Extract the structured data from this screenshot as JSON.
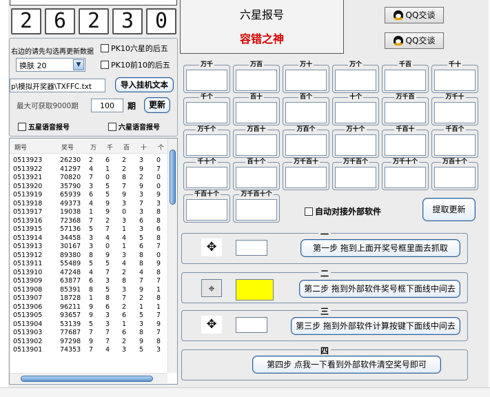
{
  "digits": [
    "2",
    "6",
    "2",
    "3",
    "0"
  ],
  "left": {
    "hint": "右边的请先勾选再更新数据",
    "pk10_six_back5": "PK10六星的后五",
    "pk10_top10_back5": "PK10前10的后五",
    "skin_select": "换肤 20",
    "path_value": "p\\模拟开奖器\\TXFFC.txt",
    "import_button": "导入挂机文本",
    "max_label": "最大可获取9000期",
    "count_value": "100",
    "period_label": "期",
    "update_button": "更新",
    "voice_five": "五星语音报号",
    "voice_six": "六星语音报号"
  },
  "history": {
    "headers": [
      "期号",
      "奖号",
      "万",
      "千",
      "百",
      "十",
      "个"
    ],
    "rows": [
      [
        "0513923",
        "26230",
        "2",
        "6",
        "2",
        "3",
        "0"
      ],
      [
        "0513922",
        "41297",
        "4",
        "1",
        "2",
        "9",
        "7"
      ],
      [
        "0513921",
        "70820",
        "7",
        "0",
        "8",
        "2",
        "0"
      ],
      [
        "0513920",
        "35790",
        "3",
        "5",
        "7",
        "9",
        "0"
      ],
      [
        "0513919",
        "65939",
        "6",
        "5",
        "9",
        "3",
        "9"
      ],
      [
        "0513918",
        "49373",
        "4",
        "9",
        "3",
        "7",
        "3"
      ],
      [
        "0513917",
        "19038",
        "1",
        "9",
        "0",
        "3",
        "8"
      ],
      [
        "0513916",
        "72368",
        "7",
        "2",
        "3",
        "6",
        "8"
      ],
      [
        "0513915",
        "57136",
        "5",
        "7",
        "1",
        "3",
        "6"
      ],
      [
        "0513914",
        "34458",
        "3",
        "4",
        "4",
        "5",
        "8"
      ],
      [
        "0513913",
        "30167",
        "3",
        "0",
        "1",
        "6",
        "7"
      ],
      [
        "0513912",
        "89380",
        "8",
        "9",
        "3",
        "8",
        "0"
      ],
      [
        "0513911",
        "55489",
        "5",
        "5",
        "4",
        "8",
        "9"
      ],
      [
        "0513910",
        "47248",
        "4",
        "7",
        "2",
        "4",
        "8"
      ],
      [
        "0513909",
        "63877",
        "6",
        "3",
        "8",
        "7",
        "7"
      ],
      [
        "0513908",
        "85391",
        "8",
        "5",
        "3",
        "9",
        "1"
      ],
      [
        "0513907",
        "18728",
        "1",
        "8",
        "7",
        "2",
        "8"
      ],
      [
        "0513906",
        "96211",
        "9",
        "6",
        "2",
        "1",
        "1"
      ],
      [
        "0513905",
        "93657",
        "9",
        "3",
        "6",
        "5",
        "7"
      ],
      [
        "0513904",
        "53139",
        "5",
        "3",
        "1",
        "3",
        "9"
      ],
      [
        "0513903",
        "77687",
        "7",
        "7",
        "6",
        "8",
        "7"
      ],
      [
        "0513902",
        "97298",
        "9",
        "7",
        "2",
        "9",
        "8"
      ],
      [
        "0513901",
        "74353",
        "7",
        "4",
        "3",
        "5",
        "3"
      ]
    ]
  },
  "header": {
    "title": "六星报号",
    "subtitle": "容错之神",
    "qq_button_1": "QQ交谈",
    "qq_button_2": "QQ交谈"
  },
  "groups": [
    [
      "万千",
      "万百",
      "万十",
      "万个",
      "千百",
      "千十"
    ],
    [
      "千个",
      "百十",
      "百个",
      "十个",
      "万千百",
      "万千十"
    ],
    [
      "万千个",
      "万百十",
      "万百个",
      "万十个",
      "千百十",
      "千百个"
    ],
    [
      "千十个",
      "百十个",
      "万千百十",
      "万千百个",
      "万千十个",
      "万百十个"
    ],
    [
      "千百十个",
      "万千百十个"
    ]
  ],
  "auto_connect": "自动对接外部软件",
  "fetch_update_button": "提取更新",
  "steps": [
    {
      "title": "一",
      "button": "第一步  拖到上面开奖号框里面去抓取"
    },
    {
      "title": "二",
      "button": "第二步  拖到外部软件奖号框下面线中间去"
    },
    {
      "title": "三",
      "button": "第三步  拖到外部软件计算按键下面线中间去"
    },
    {
      "title": "四",
      "button": "第四步  点我一下看到外部软件清空奖号即可"
    }
  ],
  "colors": {
    "panel": "#ececec",
    "accent_red": "#d40000",
    "highlight_yellow": "#ffff00",
    "border_blue": "#2d5f97"
  },
  "icons": {
    "step_drag": "move-crosshair-icon",
    "qq": "qq-penguin-icon",
    "dropdown": "chevron-down-icon"
  }
}
